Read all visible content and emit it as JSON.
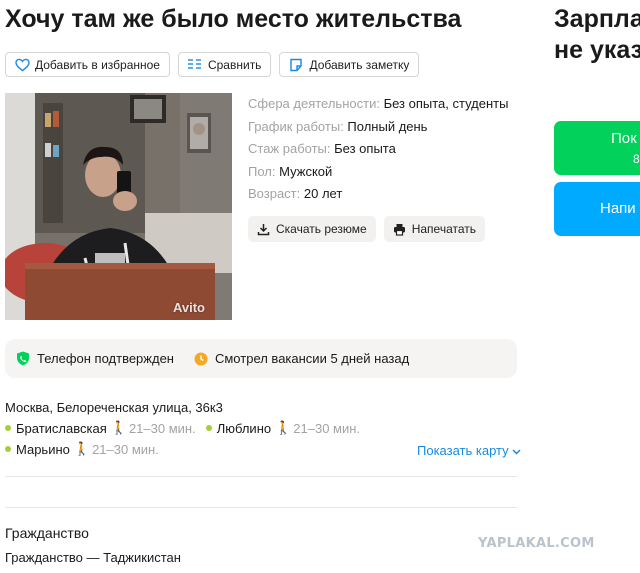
{
  "header": {
    "title": "Хочу там же было место жительства",
    "salary": "Зарпла\nне указ"
  },
  "toolbar": {
    "favorite_label": "Добавить в избранное",
    "compare_label": "Сравнить",
    "note_label": "Добавить заметку"
  },
  "photo": {
    "watermark": "Avito"
  },
  "details": [
    {
      "label": "Сфера деятельности:",
      "value": "Без опыта, студенты"
    },
    {
      "label": "График работы:",
      "value": "Полный день"
    },
    {
      "label": "Стаж работы:",
      "value": "Без опыта"
    },
    {
      "label": "Пол:",
      "value": "Мужской"
    },
    {
      "label": "Возраст:",
      "value": "20 лет"
    }
  ],
  "actions": {
    "download_label": "Скачать резюме",
    "print_label": "Напечатать"
  },
  "status": {
    "phone": "Телефон подтвержден",
    "viewed": "Смотрел вакансии 5 дней назад",
    "phone_color": "#02d15c",
    "viewed_color": "#f7a823"
  },
  "location": {
    "address": "Москва, Белореченская улица, 36к3",
    "metro": [
      {
        "name": "Братиславская",
        "time": "21–30 мин."
      },
      {
        "name": "Люблино",
        "time": "21–30 мин."
      },
      {
        "name": "Марьино",
        "time": "21–30 мин."
      }
    ],
    "metro_color": "#a5cd39",
    "show_map": "Показать карту"
  },
  "citizenship": {
    "heading": "Гражданство",
    "value": "Гражданство — Таджикистан"
  },
  "side": {
    "show_phone_main": "Пок",
    "show_phone_sub": "8",
    "write_label": "Напи"
  },
  "watermark_site": "YAPLAKAL.COM",
  "colors": {
    "accent_blue": "#00aaff",
    "accent_green": "#02d15c",
    "link": "#1a8ae0"
  }
}
